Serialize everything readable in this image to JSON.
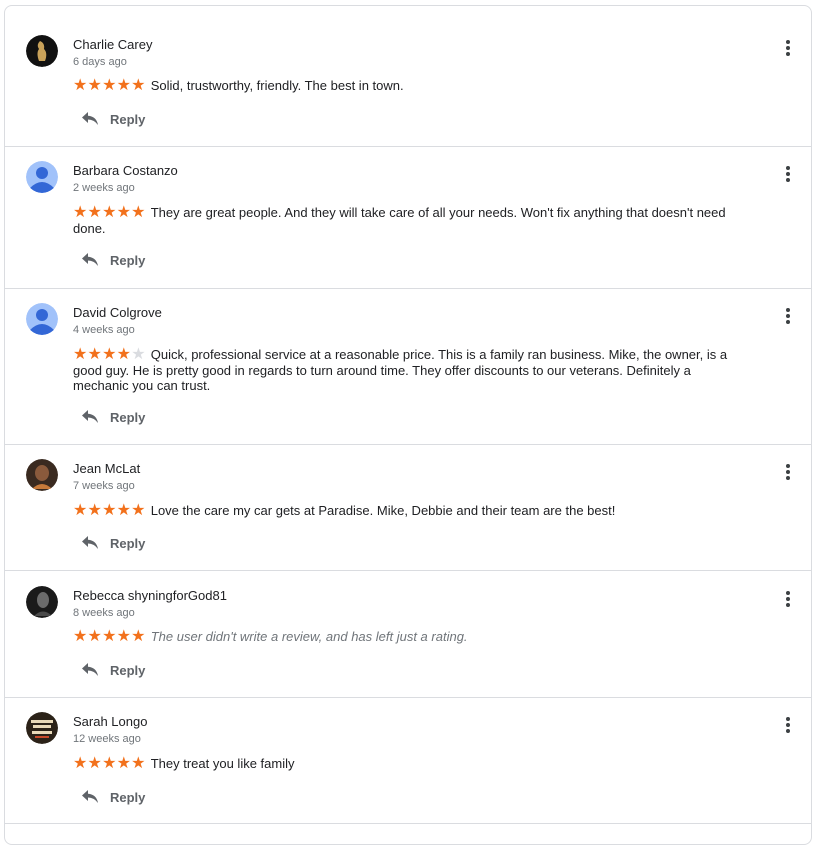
{
  "colors": {
    "star": "#f2711c",
    "star_empty": "#dadce0",
    "muted": "#70757a",
    "divider": "#dadce0"
  },
  "reviews": [
    {
      "name": "Charlie Carey",
      "date": "6 days ago",
      "rating": 5,
      "text": "Solid, trustworthy, friendly. The best in town.",
      "reply_label": "Reply",
      "avatar": "photo-avatar-icon"
    },
    {
      "name": "Barbara Costanzo",
      "date": "2 weeks ago",
      "rating": 5,
      "text": "They are great people. And they will take care of all your needs. Won't fix anything that doesn't need done.",
      "reply_label": "Reply",
      "avatar": "default-user-avatar-icon"
    },
    {
      "name": "David Colgrove",
      "date": "4 weeks ago",
      "rating": 4,
      "text": "Quick, professional service at a reasonable price. This is a family ran business. Mike, the owner, is a good guy. He is pretty good in regards to turn around time. They offer discounts to our veterans. Definitely a mechanic you can trust.",
      "reply_label": "Reply",
      "avatar": "default-user-avatar-icon"
    },
    {
      "name": "Jean McLat",
      "date": "7 weeks ago",
      "rating": 5,
      "text": "Love the care my car gets at Paradise. Mike, Debbie and their team are the best!",
      "reply_label": "Reply",
      "avatar": "photo-avatar-icon"
    },
    {
      "name": "Rebecca shyningforGod81",
      "date": "8 weeks ago",
      "rating": 5,
      "text": "The user didn't write a review, and has left just a rating.",
      "reply_label": "Reply",
      "avatar": "photo-avatar-icon"
    },
    {
      "name": "Sarah Longo",
      "date": "12 weeks ago",
      "rating": 5,
      "text": "They treat you like family",
      "reply_label": "Reply",
      "avatar": "photo-avatar-icon"
    }
  ]
}
